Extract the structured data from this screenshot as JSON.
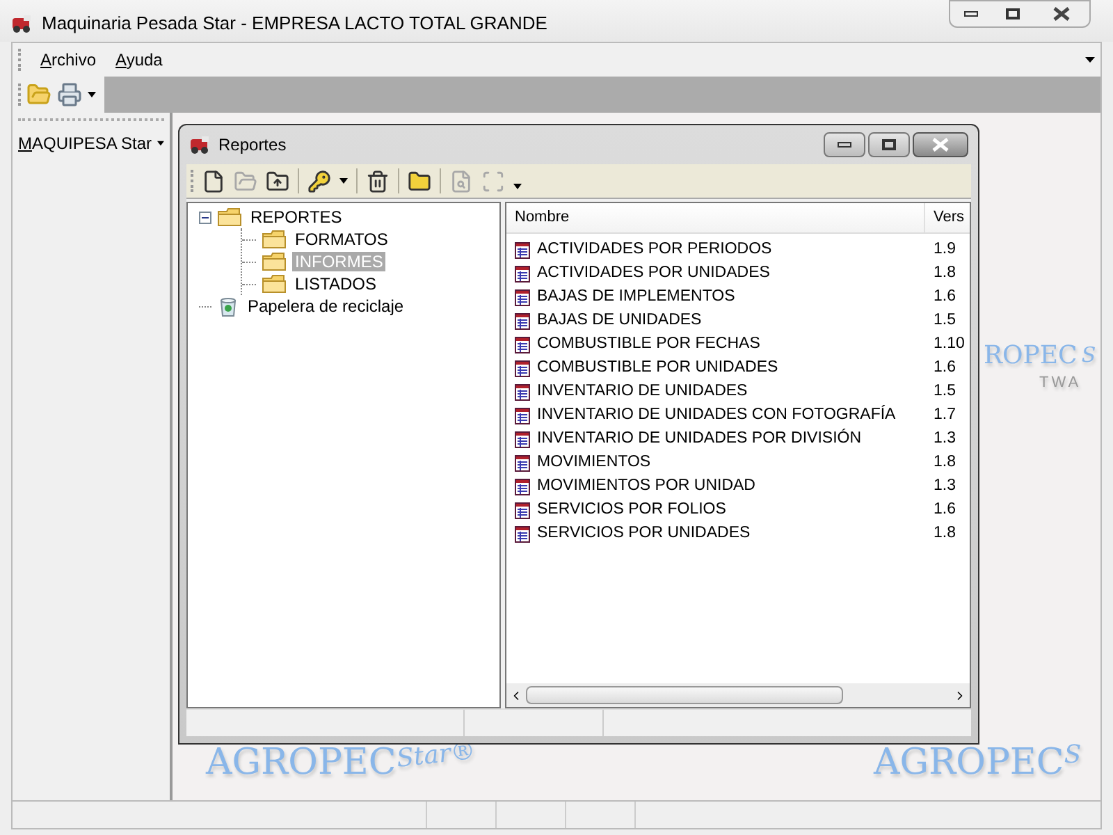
{
  "window": {
    "title": "Maquinaria Pesada Star - EMPRESA LACTO TOTAL GRANDE"
  },
  "menu": [
    {
      "label": "Archivo"
    },
    {
      "label": "Ayuda"
    }
  ],
  "toolbar": [
    {
      "kind": "open"
    },
    {
      "kind": "print"
    }
  ],
  "sidebar": {
    "selector": "MAQUIPESA Star"
  },
  "background_logos": [
    {
      "word": "AGROPEC",
      "script": "Star®"
    },
    {
      "word": "AGROPEC",
      "script": "S"
    }
  ],
  "hidden_logo": {
    "word": "ROPEC",
    "script": "S",
    "tagline": "TWA"
  },
  "child_window": {
    "title": "Reportes",
    "toolbar": [
      {
        "kind": "new",
        "disabled": false
      },
      {
        "kind": "open",
        "disabled": true
      },
      {
        "kind": "export",
        "disabled": false
      },
      {
        "kind": "key",
        "disabled": false
      },
      {
        "kind": "delete",
        "disabled": false
      },
      {
        "kind": "new-folder",
        "disabled": false
      },
      {
        "kind": "preview",
        "disabled": true
      },
      {
        "kind": "fit",
        "disabled": true
      }
    ],
    "tree": [
      {
        "label": "REPORTES",
        "kind": "folder",
        "expanded": true,
        "selected": false,
        "children": [
          {
            "label": "FORMATOS",
            "kind": "folder",
            "selected": false
          },
          {
            "label": "INFORMES",
            "kind": "folder",
            "selected": true
          },
          {
            "label": "LISTADOS",
            "kind": "folder",
            "selected": false
          }
        ]
      },
      {
        "label": "Papelera de reciclaje",
        "kind": "recycle",
        "selected": false
      }
    ],
    "list": {
      "columns": [
        "Nombre",
        "Vers"
      ],
      "rows": [
        {
          "name": "ACTIVIDADES POR PERIODOS",
          "version": "1.9"
        },
        {
          "name": "ACTIVIDADES POR UNIDADES",
          "version": "1.8"
        },
        {
          "name": "BAJAS DE IMPLEMENTOS",
          "version": "1.6"
        },
        {
          "name": "BAJAS DE UNIDADES",
          "version": "1.5"
        },
        {
          "name": "COMBUSTIBLE POR FECHAS",
          "version": "1.10"
        },
        {
          "name": "COMBUSTIBLE POR UNIDADES",
          "version": "1.6"
        },
        {
          "name": "INVENTARIO DE UNIDADES",
          "version": "1.5"
        },
        {
          "name": "INVENTARIO DE UNIDADES CON FOTOGRAFÍA",
          "version": "1.7"
        },
        {
          "name": "INVENTARIO DE UNIDADES POR DIVISIÓN",
          "version": "1.3"
        },
        {
          "name": "MOVIMIENTOS",
          "version": "1.8"
        },
        {
          "name": "MOVIMIENTOS POR UNIDAD",
          "version": "1.3"
        },
        {
          "name": "SERVICIOS POR FOLIOS",
          "version": "1.6"
        },
        {
          "name": "SERVICIOS POR UNIDADES",
          "version": "1.8"
        }
      ]
    }
  }
}
